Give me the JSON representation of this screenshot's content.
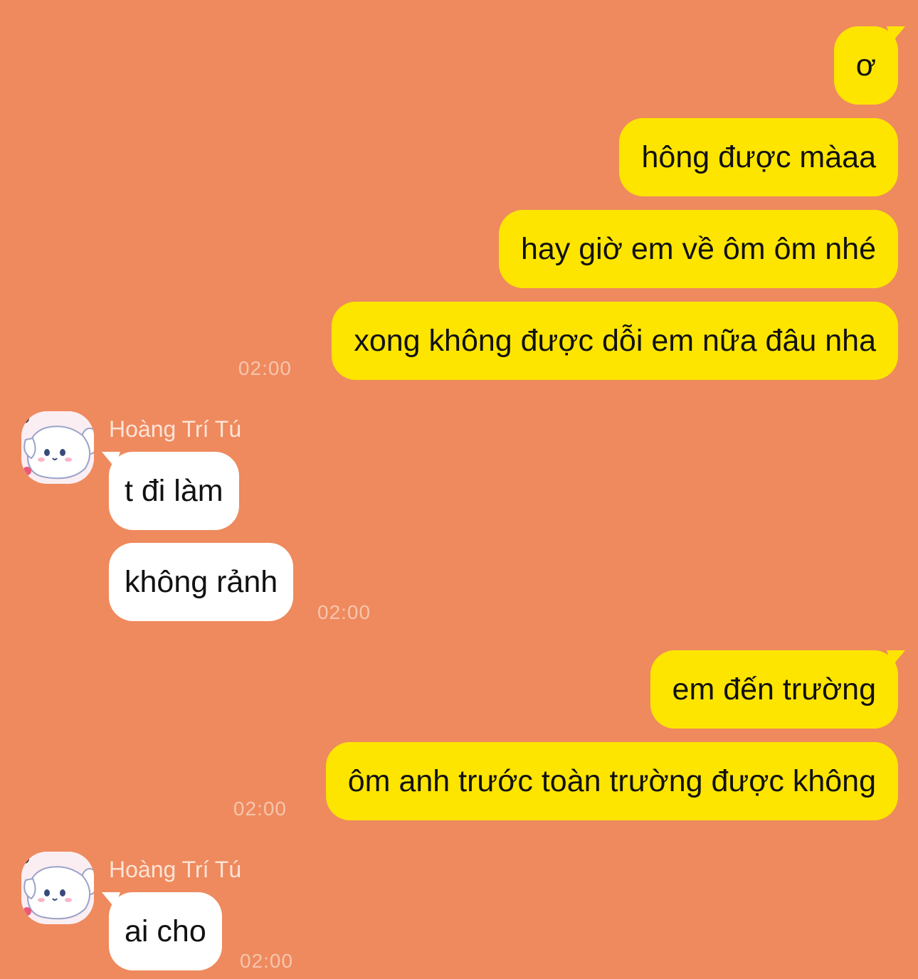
{
  "colors": {
    "background": "#ee8a5e",
    "outgoing_bubble": "#fee500",
    "incoming_bubble": "#ffffff",
    "timestamp": "#f7c5ad",
    "sender_name": "#fde3d6"
  },
  "messages": {
    "m1": "ơ",
    "m2": "hông được màaa",
    "m3": "hay giờ em về ôm ôm nhé",
    "m4": "xong không được dỗi em nữa đâu nha",
    "t1": "02:00",
    "s1": "Hoàng Trí Tú",
    "m5": "t đi làm",
    "m6": "không rảnh",
    "t2": "02:00",
    "m7": "em đến trường",
    "m8": "ôm anh trước toàn trường được không",
    "t3": "02:00",
    "s2": "Hoàng Trí Tú",
    "m9": "ai cho",
    "t4": "02:00"
  },
  "avatar_icon": "cinnamoroll-avatar-icon"
}
